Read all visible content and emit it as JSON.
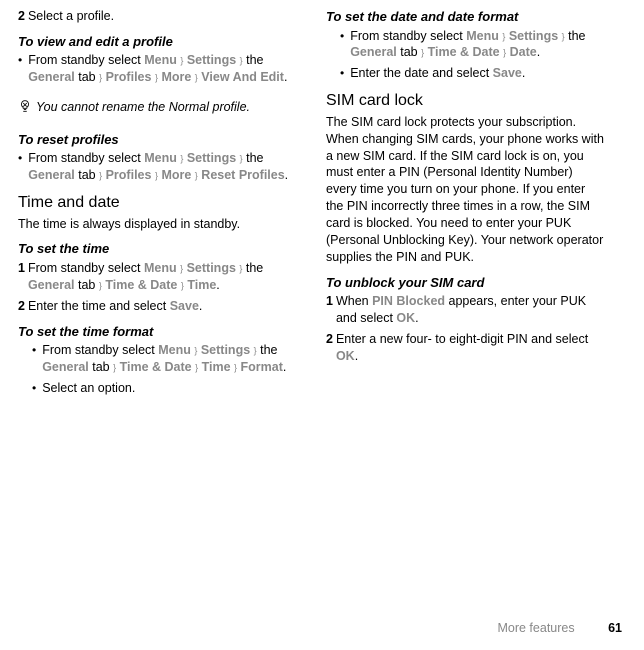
{
  "left": {
    "step2": {
      "num": "2",
      "text": "Select a profile."
    },
    "h_view_edit": "To view and edit a profile",
    "view_edit_b1": {
      "pre": "From standby select ",
      "m1": "Menu",
      "a1": "}",
      "m2": "Settings",
      "a2": "}",
      "mid1": " the ",
      "m3": "General",
      "post_tab": " tab ",
      "a3": "}",
      "m4": "Profiles",
      "a4": "}",
      "m5": "More",
      "a5": "}",
      "m6": "View And Edit",
      "dot": "."
    },
    "tip": "You cannot rename the Normal profile.",
    "h_reset": "To reset profiles",
    "reset_b1": {
      "pre": "From standby select ",
      "m1": "Menu",
      "a1": "}",
      "m2": "Settings",
      "a2": "}",
      "mid1": " the ",
      "m3": "General",
      "post_tab": " tab ",
      "a3": "}",
      "m4": "Profiles",
      "a4": "}",
      "m5": "More",
      "a5": "}",
      "m6": "Reset Profiles",
      "dot": "."
    },
    "h_time_date": "Time and date",
    "time_date_desc": "The time is always displayed in standby.",
    "h_set_time": "To set the time",
    "set_time_1": {
      "num": "1",
      "pre": "From standby select ",
      "m1": "Menu",
      "a1": "}",
      "m2": "Settings",
      "a2": "}",
      "mid1": " the ",
      "m3": "General",
      "post_tab": " tab ",
      "a3": "}",
      "m4": "Time & Date",
      "a4": "}",
      "m5": "Time",
      "dot": "."
    },
    "set_time_2": {
      "num": "2",
      "pre": "Enter the time and select ",
      "m1": "Save",
      "dot": "."
    },
    "h_set_tfmt": "To set the time format",
    "set_tfmt_b1": {
      "pre": "From standby select ",
      "m1": "Menu",
      "a1": "}",
      "m2": "Settings",
      "a2": "}",
      "mid1": " the ",
      "m3": "General",
      "post_tab": " tab ",
      "a3": "}",
      "m4": "Time & Date",
      "a4": "}",
      "m5": "Time",
      "a5": "}",
      "m6": "Format",
      "dot": "."
    },
    "set_tfmt_b2": "Select an option."
  },
  "right": {
    "h_set_date": "To set the date and date format",
    "set_date_b1": {
      "pre": "From standby select ",
      "m1": "Menu",
      "a1": "}",
      "m2": "Settings",
      "a2": "}",
      "mid1": " the ",
      "m3": "General",
      "post_tab": " tab ",
      "a3": "}",
      "m4": "Time & Date",
      "a4": "}",
      "m5": "Date",
      "dot": "."
    },
    "set_date_b2": {
      "pre": "Enter the date and select ",
      "m1": "Save",
      "dot": "."
    },
    "h_sim": "SIM card lock",
    "sim_desc": "The SIM card lock protects your subscription. When changing SIM cards, your phone works with a new SIM card. If the SIM card lock is on, you must enter a PIN (Personal Identity Number) every time you turn on your phone. If you enter the PIN incorrectly three times in a row, the SIM card is blocked. You need to enter your PUK (Personal Unblocking Key). Your network operator supplies the PIN and PUK.",
    "h_unblock": "To unblock your SIM card",
    "unblock_1": {
      "num": "1",
      "pre": "When ",
      "m1": "PIN Blocked",
      "mid": " appears, enter your PUK and select ",
      "m2": "OK",
      "dot": "."
    },
    "unblock_2": {
      "num": "2",
      "pre": "Enter a new four- to eight-digit PIN and select ",
      "m1": "OK",
      "dot": "."
    }
  },
  "footer": {
    "section": "More features",
    "page": "61"
  }
}
